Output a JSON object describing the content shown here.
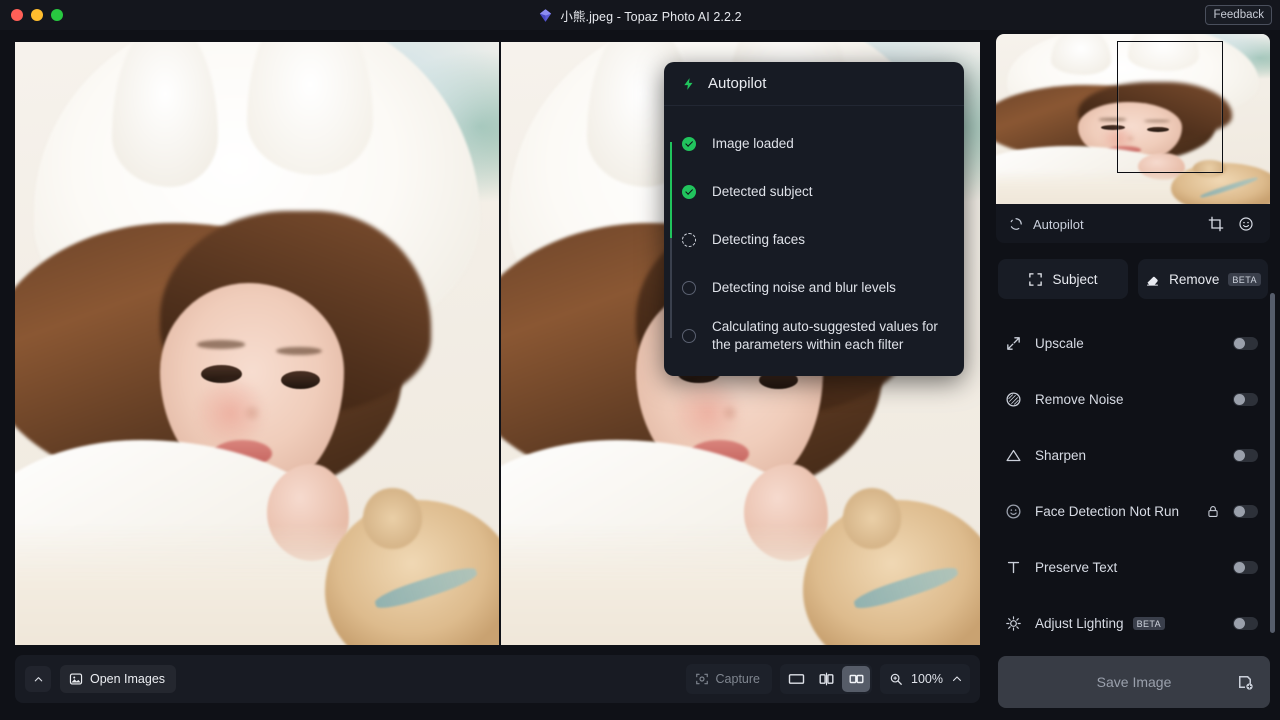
{
  "titlebar": {
    "title": "小熊.jpeg - Topaz Photo AI 2.2.2",
    "app_icon": "gem-icon",
    "feedback_label": "Feedback",
    "traffic_lights": [
      "close-red",
      "minimize-yellow",
      "zoom-green"
    ]
  },
  "autopilot_popup": {
    "icon": "lightning-bolt-icon",
    "title": "Autopilot",
    "steps": [
      {
        "label": "Image loaded",
        "state": "done"
      },
      {
        "label": "Detected subject",
        "state": "done"
      },
      {
        "label": "Detecting faces",
        "state": "active"
      },
      {
        "label": "Detecting noise and blur levels",
        "state": "pending"
      },
      {
        "label": "Calculating auto-suggested values for the parameters within each filter",
        "state": "pending"
      }
    ],
    "accent_done": "#21c45d"
  },
  "bottom_toolbar": {
    "collapse_icon": "chevron-up-icon",
    "open_images_label": "Open Images",
    "open_images_icon": "image-icon",
    "capture_label": "Capture",
    "capture_icon": "capture-icon",
    "view_modes": [
      {
        "name": "single-view",
        "icon": "rectangle-icon",
        "active": false
      },
      {
        "name": "split-view",
        "icon": "split-compare-icon",
        "active": false
      },
      {
        "name": "side-by-side-view",
        "icon": "two-panes-icon",
        "active": true
      }
    ],
    "zoom_icon": "magnifier-icon",
    "zoom_value": "100%",
    "zoom_chevron": "chevron-up-icon"
  },
  "sidebar": {
    "preview": {
      "autopilot_label": "Autopilot",
      "spinner_icon": "spinner-icon",
      "crop_icon": "crop-icon",
      "face_icon": "smiley-icon"
    },
    "mode_buttons": [
      {
        "label": "Subject",
        "icon": "subject-frame-icon",
        "badge": ""
      },
      {
        "label": "Remove",
        "icon": "eraser-icon",
        "badge": "BETA"
      }
    ],
    "filters": [
      {
        "label": "Upscale",
        "icon": "upscale-arrows-icon",
        "badge": "",
        "locked": false,
        "enabled": false
      },
      {
        "label": "Remove Noise",
        "icon": "noise-circle-icon",
        "badge": "",
        "locked": false,
        "enabled": false
      },
      {
        "label": "Sharpen",
        "icon": "triangle-icon",
        "badge": "",
        "locked": false,
        "enabled": false
      },
      {
        "label": "Face Detection Not Run",
        "icon": "smiley-icon",
        "badge": "",
        "locked": true,
        "enabled": false
      },
      {
        "label": "Preserve Text",
        "icon": "text-t-icon",
        "badge": "",
        "locked": false,
        "enabled": false
      },
      {
        "label": "Adjust Lighting",
        "icon": "sun-icon",
        "badge": "BETA",
        "locked": false,
        "enabled": false
      }
    ],
    "save_label": "Save Image",
    "save_icon": "save-image-icon"
  }
}
